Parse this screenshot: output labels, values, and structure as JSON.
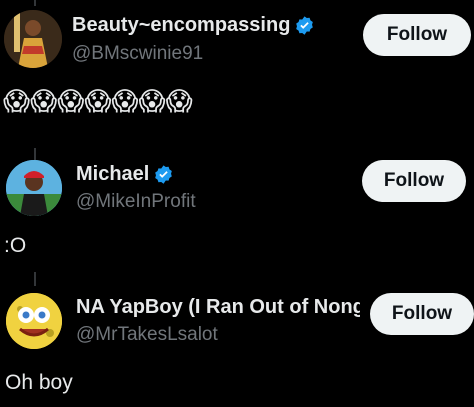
{
  "posts": [
    {
      "name": "Beauty~encompassing",
      "handle": "@BMscwinie91",
      "verified": true,
      "follow_label": "Follow",
      "text": "😱😱😱😱😱😱😱"
    },
    {
      "name": "Michael",
      "handle": "@MikeInProfit",
      "verified": true,
      "follow_label": "Follow",
      "text": ":O"
    },
    {
      "name": "NA YapBoy (I Ran Out of Nonɡ",
      "handle": "@MrTakesLsalot",
      "verified": false,
      "follow_label": "Follow",
      "text": "Oh boy"
    }
  ],
  "icons": {
    "verified": "verified-badge-icon"
  },
  "colors": {
    "background": "#000000",
    "text": "#e7e9ea",
    "secondary": "#71767b",
    "verified": "#1d9bf0",
    "follow_bg": "#eff3f4"
  }
}
